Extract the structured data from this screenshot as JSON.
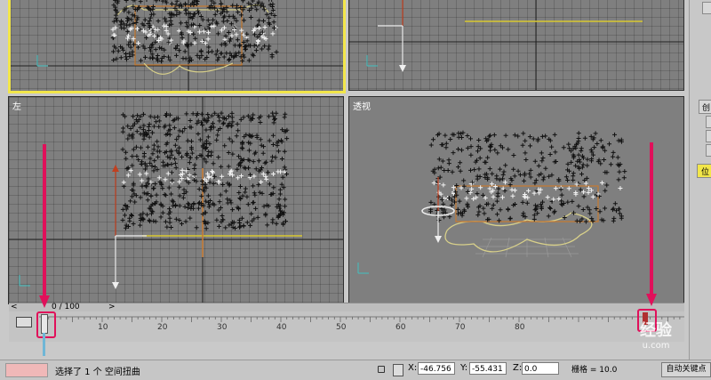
{
  "viewports": {
    "left": {
      "label": "左"
    },
    "perspective": {
      "label": "透视"
    }
  },
  "frame_slider": {
    "text": "0 / 100",
    "prev_symbol": "<",
    "next_symbol": ">",
    "current_frame": 0,
    "total_frames": 100
  },
  "timeline": {
    "ticks": [
      "10",
      "20",
      "30",
      "40",
      "50",
      "60",
      "70",
      "80"
    ],
    "start_tick": "0",
    "highlight_color": "#e0105a"
  },
  "right_panel": {
    "tab_label": "创",
    "position_label": "位"
  },
  "status": {
    "selection_text": "选择了 1 个 空间扭曲",
    "x_label": "X:",
    "x_value": "-46.756",
    "y_label": "Y:",
    "y_value": "-55.431",
    "z_label": "Z:",
    "z_value": "0.0",
    "grid_label": "栅格 = 10.0",
    "auto_key_label": "自动关键点"
  },
  "watermark": {
    "line1": "经验",
    "line2": "u.com"
  },
  "colors": {
    "viewport_bg": "#7f7f7f",
    "active_border": "#f2e64a",
    "accent_pink": "#e0105a"
  }
}
